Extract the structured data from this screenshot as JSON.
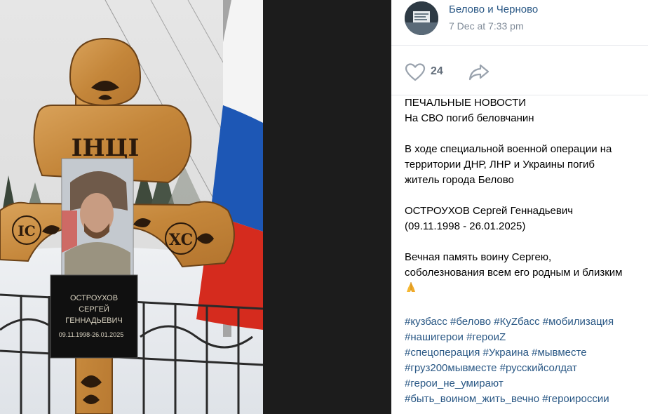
{
  "post": {
    "group_name": "Белово и Черново",
    "date": "7 Dec at 7:33 pm",
    "likes": "24",
    "text": {
      "heading": "ПЕЧАЛЬНЫЕ НОВОСТИ",
      "line1": "На СВО погиб беловчанин",
      "para2_l1": "В ходе специальной военной операции на",
      "para2_l2": "территории ДНР, ЛНР и Украины погиб",
      "para2_l3": "житель города Белово",
      "name": "ОСТРОУХОВ Сергей Геннадьевич",
      "dates": "(09.11.1998 - 26.01.2025)",
      "para4_l1": "Вечная память воину Сергею,",
      "para4_l2": "соболезнования всем его родным и близким"
    },
    "hashtags": [
      [
        "#кузбасс",
        "#белово",
        "#КуZбасс",
        "#мобилизация"
      ],
      [
        "#нашигерои",
        "#героиZ"
      ],
      [
        "#спецоперация",
        "#Украина",
        "#мывместе"
      ],
      [
        "#груз200мывместе",
        "#русскийсолдат"
      ],
      [
        "#герои_не_умирают"
      ],
      [
        "#быть_воином_жить_вечно",
        "#героироссии"
      ]
    ]
  },
  "photo": {
    "plaque_lines": [
      "ОСТРОУХОВ",
      "СЕРГЕЙ",
      "ГЕННАДЬЕВИЧ",
      "09.11.1998-26.01.2025"
    ],
    "cross_letters": [
      "IНЦI",
      "IC",
      "XC"
    ]
  },
  "colors": {
    "link": "#2a5885",
    "meta": "#818c99",
    "wood": "#c98b3c",
    "flag_blue": "#1d57b5",
    "flag_red": "#d52b1e"
  },
  "icons": {
    "like": "heart-outline",
    "share": "share-arrow",
    "emoji": "folded-hands"
  }
}
